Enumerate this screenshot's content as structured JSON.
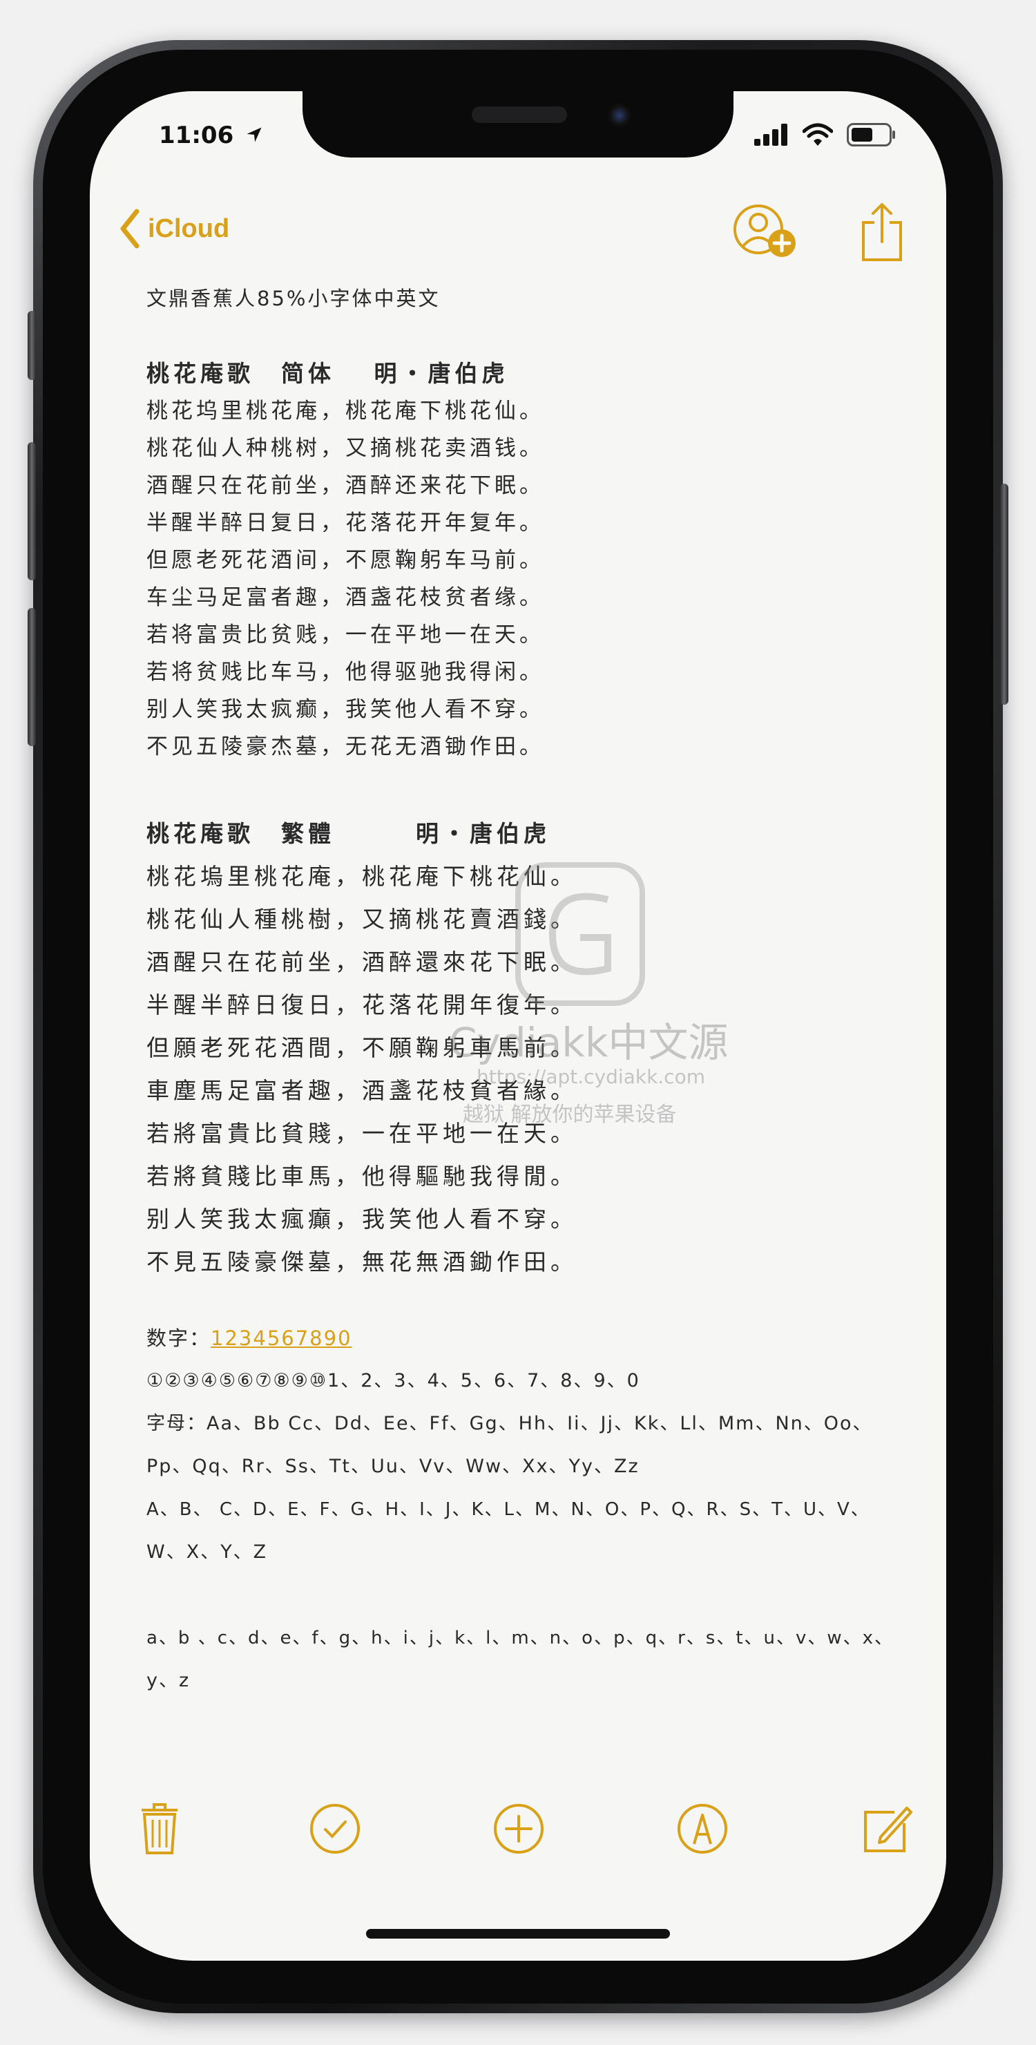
{
  "status_bar": {
    "time": "11:06"
  },
  "nav": {
    "back_label": "iCloud"
  },
  "note": {
    "title": "文鼎香蕉人85%小字体中英文",
    "simplified": {
      "heading": "桃花庵歌　简体　 明・唐伯虎",
      "lines": [
        "桃花坞里桃花庵，桃花庵下桃花仙。",
        "桃花仙人种桃树，又摘桃花卖酒钱。",
        "酒醒只在花前坐，酒醉还来花下眠。",
        "半醒半醉日复日，花落花开年复年。",
        "但愿老死花酒间，不愿鞠躬车马前。",
        "车尘马足富者趣，酒盏花枝贫者缘。",
        "若将富贵比贫贱，一在平地一在天。",
        "若将贫贱比车马，他得驱驰我得闲。",
        "别人笑我太疯癫，我笑他人看不穿。",
        "不见五陵豪杰墓，无花无酒锄作田。"
      ]
    },
    "traditional": {
      "heading": "桃花庵歌　繁體　　　明・唐伯虎",
      "lines": [
        "桃花塢里桃花庵，桃花庵下桃花仙。",
        "桃花仙人種桃樹，又摘桃花賣酒錢。",
        "酒醒只在花前坐，酒醉還來花下眠。",
        "半醒半醉日復日，花落花開年復年。",
        "但願老死花酒間，不願鞠躬車馬前。",
        "車塵馬足富者趣，酒盞花枝貧者緣。",
        "若將富貴比貧賤，一在平地一在天。",
        "若將貧賤比車馬，他得驅馳我得閒。",
        "别人笑我太瘋癲，我笑他人看不穿。",
        "不見五陵豪傑墓，無花無酒鋤作田。"
      ]
    },
    "digits_label": "数字：",
    "digits_value": "1234567890",
    "circled_digits": "①②③④⑤⑥⑦⑧⑨⑩1、2、3、4、5、6、7、8、9、0",
    "letters_line1": "字母：Aa、Bb Cc、Dd、Ee、Ff、Gg、Hh、Ii、Jj、Kk、Ll、Mm、Nn、Oo、",
    "letters_line2": "Pp、Qq、Rr、Ss、Tt、Uu、Vv、Ww、Xx、Yy、Zz",
    "upper_line1": "A、B、 C、D、E、F、G、H、I、J、K、L、M、N、O、P、Q、R、S、T、U、V、",
    "upper_line2": "W、X、Y、Z",
    "lower_line1": "a、b 、c、d、e、f、g、h、i、j、k、l、m、n、o、p、q、r、s、t、u、v、w、x、",
    "lower_line2": "y、z"
  },
  "watermark": {
    "brand": "Cydiakk中文源",
    "url": "https://apt.cydiakk.com",
    "slogan": "越狱 解放你的苹果设备"
  },
  "colors": {
    "accent": "#d9a117",
    "text": "#2a2a2a",
    "paper": "#f6f6f5"
  },
  "icons": [
    "location-arrow-icon",
    "signal-icon",
    "wifi-icon",
    "battery-icon",
    "chevron-left-icon",
    "add-people-icon",
    "share-icon",
    "trash-icon",
    "checklist-icon",
    "add-icon",
    "markup-icon",
    "compose-icon"
  ]
}
